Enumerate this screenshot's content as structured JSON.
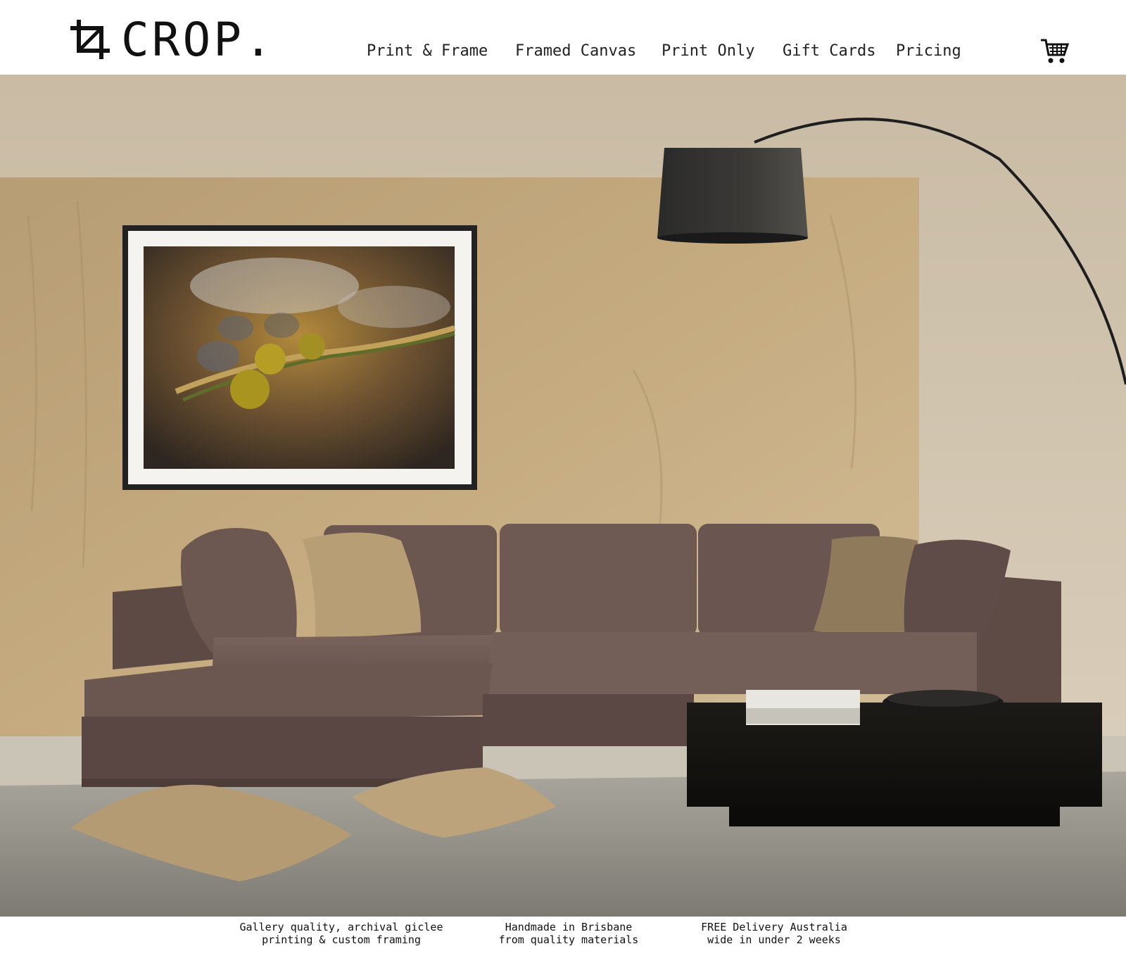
{
  "brand": {
    "name": "CROP."
  },
  "nav": {
    "items": [
      {
        "label": "Print & Frame"
      },
      {
        "label": "Framed Canvas"
      },
      {
        "label": "Print Only"
      },
      {
        "label": "Gift Cards"
      },
      {
        "label": "Pricing"
      }
    ]
  },
  "cart": {
    "icon": "shopping-cart-icon"
  },
  "features": [
    {
      "text": "Gallery quality, archival giclee\nprinting & custom framing"
    },
    {
      "text": "Handmade in Brisbane\nfrom quality materials"
    },
    {
      "text": "FREE Delivery Australia\nwide in under 2 weeks"
    }
  ],
  "colors": {
    "wall": "#c9b694",
    "wall_back": "#d8cbb4",
    "sofa": "#6e5852",
    "pillow_tan": "#b89e74",
    "rug": "#8f8e86",
    "frame": "#222222"
  }
}
